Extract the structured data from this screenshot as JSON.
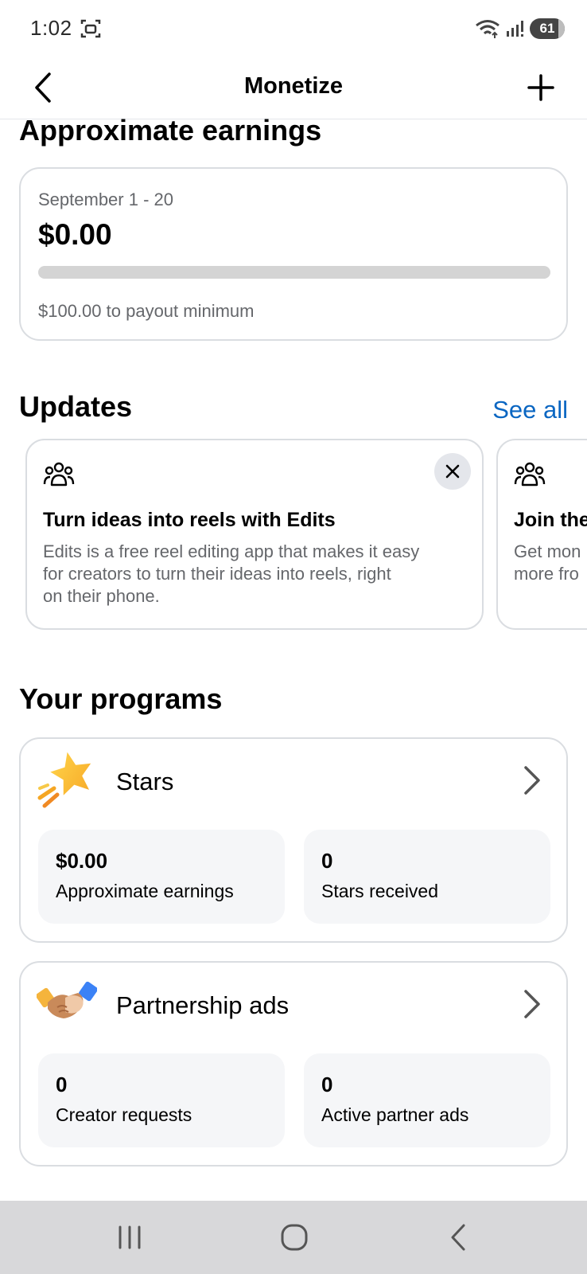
{
  "status_bar": {
    "time": "1:02",
    "battery": "61"
  },
  "header": {
    "title": "Monetize"
  },
  "earnings": {
    "heading": "Approximate earnings",
    "period": "September 1 - 20",
    "amount": "$0.00",
    "progress_fraction": 0,
    "note": "$100.00 to payout minimum"
  },
  "updates": {
    "heading": "Updates",
    "see_all": "See all",
    "cards": [
      {
        "title": "Turn ideas into reels with Edits",
        "body_lines": [
          "Edits is a free reel editing app that makes it easy",
          "for creators to turn their ideas into reels, right",
          "on their phone."
        ]
      },
      {
        "title": "Join the",
        "body_lines": [
          "Get mon",
          "more fro"
        ]
      }
    ]
  },
  "programs": {
    "heading": "Your programs",
    "items": [
      {
        "name": "Stars",
        "icon": "star-icon",
        "stats": [
          {
            "value": "$0.00",
            "label": "Approximate earnings"
          },
          {
            "value": "0",
            "label": "Stars received"
          }
        ]
      },
      {
        "name": "Partnership ads",
        "icon": "handshake-icon",
        "stats": [
          {
            "value": "0",
            "label": "Creator requests"
          },
          {
            "value": "0",
            "label": "Active partner ads"
          }
        ]
      }
    ]
  },
  "colors": {
    "link": "#0a66c2",
    "progress_track": "#d4d4d4",
    "card_border": "#dadde1"
  }
}
